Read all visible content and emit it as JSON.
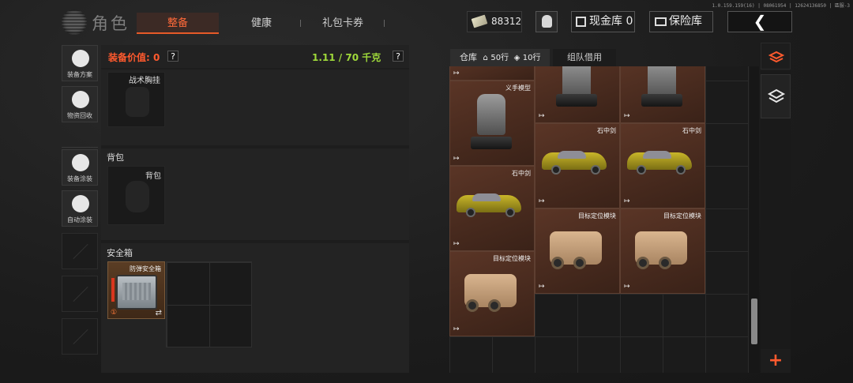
{
  "version_info": "1.0.159.159(16) | 08061954 | 12624136850 | 區服-3",
  "header": {
    "title": "角色",
    "tabs": [
      {
        "label": "整备",
        "active": true
      },
      {
        "label": "健康",
        "active": false
      },
      {
        "label": "礼包卡券",
        "active": false
      }
    ],
    "cash_amount": "88312",
    "cash_vault_label": "现金库 0",
    "safe_vault_label": "保险库",
    "back_glyph": "❮"
  },
  "sidebar": {
    "buttons": [
      {
        "label": "装备方案",
        "icon": "loadout-icon"
      },
      {
        "label": "物资回收",
        "icon": "recycle-icon"
      },
      {
        "label": "装备涂装",
        "icon": "paint-icon"
      },
      {
        "label": "自动涂装",
        "icon": "auto-paint-icon"
      }
    ]
  },
  "equipment": {
    "value_label": "装备价值: 0",
    "weight_label": "1.11 / 70 千克",
    "help_glyph": "?",
    "chest_rig_label": "战术胸挂",
    "backpack_section": "背包",
    "backpack_slot_label": "背包",
    "safe_box_section": "安全箱",
    "safe_box_item": "防弹安全箱",
    "safe_box_tag": "①",
    "swap_glyph": "⇄"
  },
  "warehouse": {
    "tab_label": "仓库",
    "rows_a": "50行",
    "rows_b": "10行",
    "team_tab": "组队借用",
    "items": [
      {
        "name": "",
        "kind": "hand"
      },
      {
        "name": "",
        "kind": "hand"
      },
      {
        "name": "",
        "kind": "hand"
      },
      {
        "name": "义手模型",
        "kind": "hand"
      },
      {
        "name": "石中剑",
        "kind": "car"
      },
      {
        "name": "石中剑",
        "kind": "car"
      },
      {
        "name": "石中剑",
        "kind": "car"
      },
      {
        "name": "目标定位模块",
        "kind": "laser"
      },
      {
        "name": "目标定位模块",
        "kind": "laser"
      },
      {
        "name": "目标定位模块",
        "kind": "laser"
      }
    ],
    "item_tag_glyph": "↦"
  },
  "right_rail": {
    "add_glyph": "+"
  },
  "colors": {
    "accent": "#ff5a2e",
    "weight_green": "#9fd93a",
    "item_bg": "#4a2c20"
  }
}
